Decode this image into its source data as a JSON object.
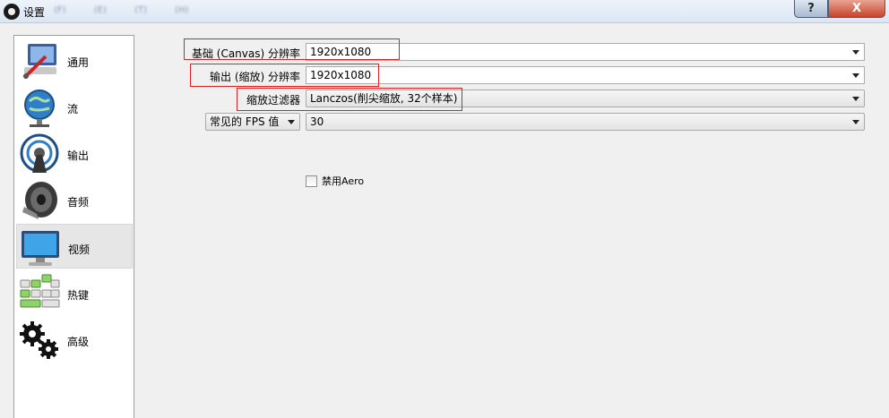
{
  "window": {
    "title": "设置",
    "ghost_menu": [
      "(F)",
      "(E)",
      "(T)",
      "(H)"
    ],
    "help_label": "?",
    "close_label": "X"
  },
  "sidebar": {
    "items": [
      {
        "label": "通用",
        "icon": "general-icon"
      },
      {
        "label": "流",
        "icon": "stream-icon"
      },
      {
        "label": "输出",
        "icon": "output-icon"
      },
      {
        "label": "音频",
        "icon": "audio-icon"
      },
      {
        "label": "视频",
        "icon": "video-icon",
        "active": true
      },
      {
        "label": "热键",
        "icon": "hotkeys-icon"
      },
      {
        "label": "高级",
        "icon": "advanced-icon"
      }
    ]
  },
  "video": {
    "base_resolution_label": "基础 (Canvas) 分辨率",
    "base_resolution_value": "1920x1080",
    "output_resolution_label": "输出 (缩放) 分辨率",
    "output_resolution_value": "1920x1080",
    "downscale_filter_label": "缩放过滤器",
    "downscale_filter_value": "Lanczos(削尖缩放, 32个样本)",
    "fps_type_label": "常见的 FPS 值",
    "fps_value": "30",
    "aero_label": "禁用Aero",
    "aero_checked": false
  },
  "colors": {
    "highlight": "#e02020",
    "title_gradient_top": "#eef3fa",
    "close_button": "#c7432b"
  }
}
